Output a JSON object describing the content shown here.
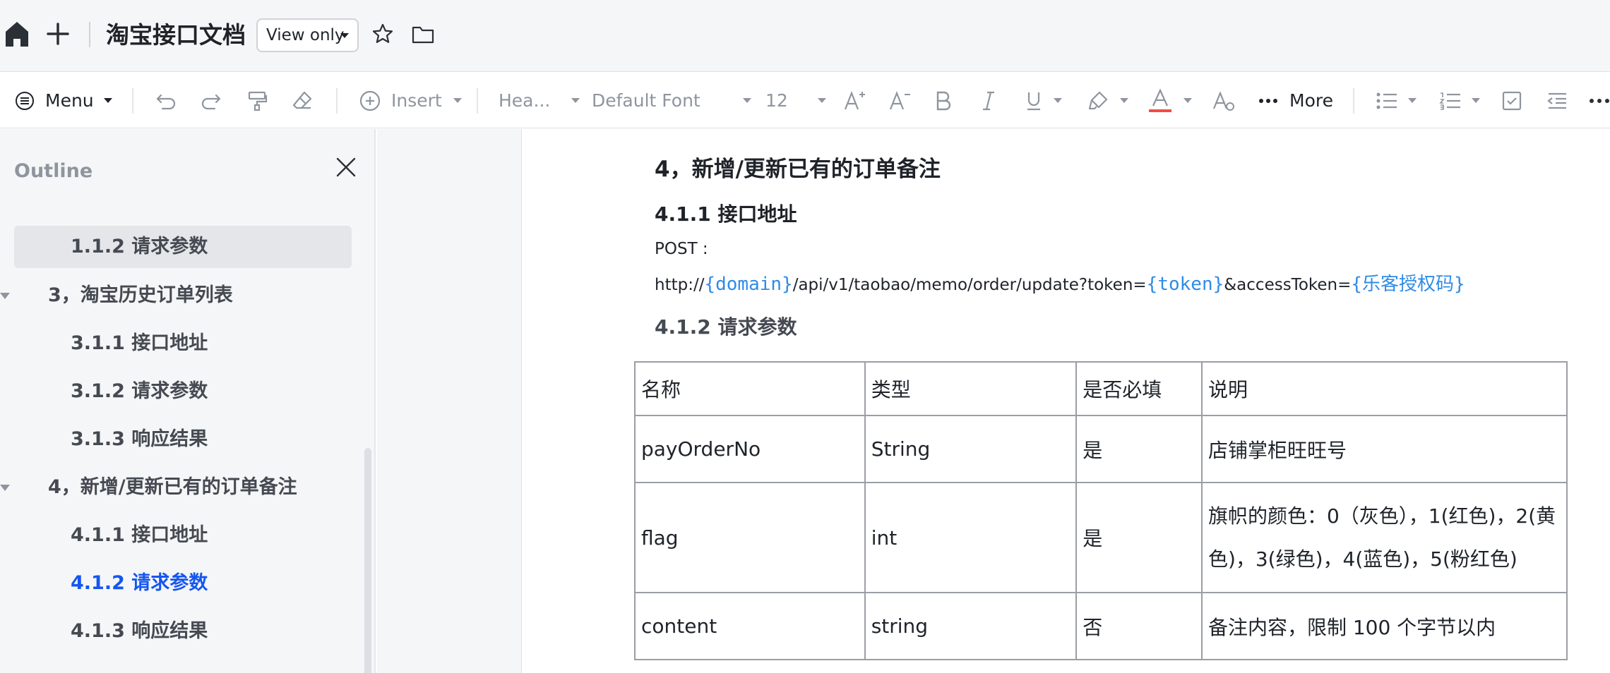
{
  "titlebar": {
    "doc_title": "淘宝接口文档",
    "permission": "View only",
    "icons": [
      "home-icon",
      "plus-icon",
      "star-icon",
      "folder-icon"
    ]
  },
  "toolbar": {
    "menu": "Menu",
    "insert": "Insert",
    "heading": "Hea...",
    "font": "Default Font",
    "font_size": "12",
    "more": "More",
    "icons": [
      "undo-icon",
      "redo-icon",
      "format-painter-icon",
      "eraser-icon",
      "insert-plus-icon",
      "increase-font-icon",
      "decrease-font-icon",
      "bold-icon",
      "italic-icon",
      "underline-icon",
      "highlight-icon",
      "text-color-icon",
      "clear-style-icon",
      "more-dots-icon",
      "bullet-list-icon",
      "numbered-list-icon",
      "checklist-icon",
      "outdent-icon",
      "overflow-icon"
    ],
    "text_color_accent": "#f54a45"
  },
  "outline": {
    "title": "Outline",
    "items": [
      {
        "label": "1.1.2  请求参数",
        "level": 3,
        "state": "hover"
      },
      {
        "label": "3，淘宝历史订单列表",
        "level": 2,
        "collapsible": true
      },
      {
        "label": "3.1.1  接口地址",
        "level": 3
      },
      {
        "label": "3.1.2  请求参数",
        "level": 3
      },
      {
        "label": "3.1.3  响应结果",
        "level": 3
      },
      {
        "label": "4，新增/更新已有的订单备注",
        "level": 2,
        "collapsible": true
      },
      {
        "label": "4.1.1  接口地址",
        "level": 3
      },
      {
        "label": "4.1.2  请求参数",
        "level": 3,
        "state": "selected"
      },
      {
        "label": "4.1.3  响应结果",
        "level": 3
      }
    ],
    "selected_color": "#1456f0"
  },
  "document": {
    "heading": "4，新增/更新已有的订单备注",
    "sub1": "4.1.1  接口地址",
    "post_label": "POST :",
    "url": {
      "prefix": "http://",
      "domain": "{domain}",
      "path": "/api/v1/taobao/memo/order/update?token=",
      "token": "{token}",
      "mid": "&accessToken=",
      "auth": "{乐客授权码}"
    },
    "sub2": "4.1.2  请求参数",
    "table": {
      "headers": [
        "名称",
        "类型",
        "是否必填",
        "说明"
      ],
      "rows": [
        [
          "payOrderNo",
          "String",
          "是",
          "店铺掌柜旺旺号"
        ],
        [
          "flag",
          "int",
          "是",
          "旗帜的颜色：0（灰色），1(红色)，2(黄色)，3(绿色)，4(蓝色)，5(粉红色)"
        ],
        [
          "content",
          "string",
          "否",
          "备注内容，限制 100 个字节以内"
        ]
      ]
    },
    "code_color": "#2f8be6"
  }
}
